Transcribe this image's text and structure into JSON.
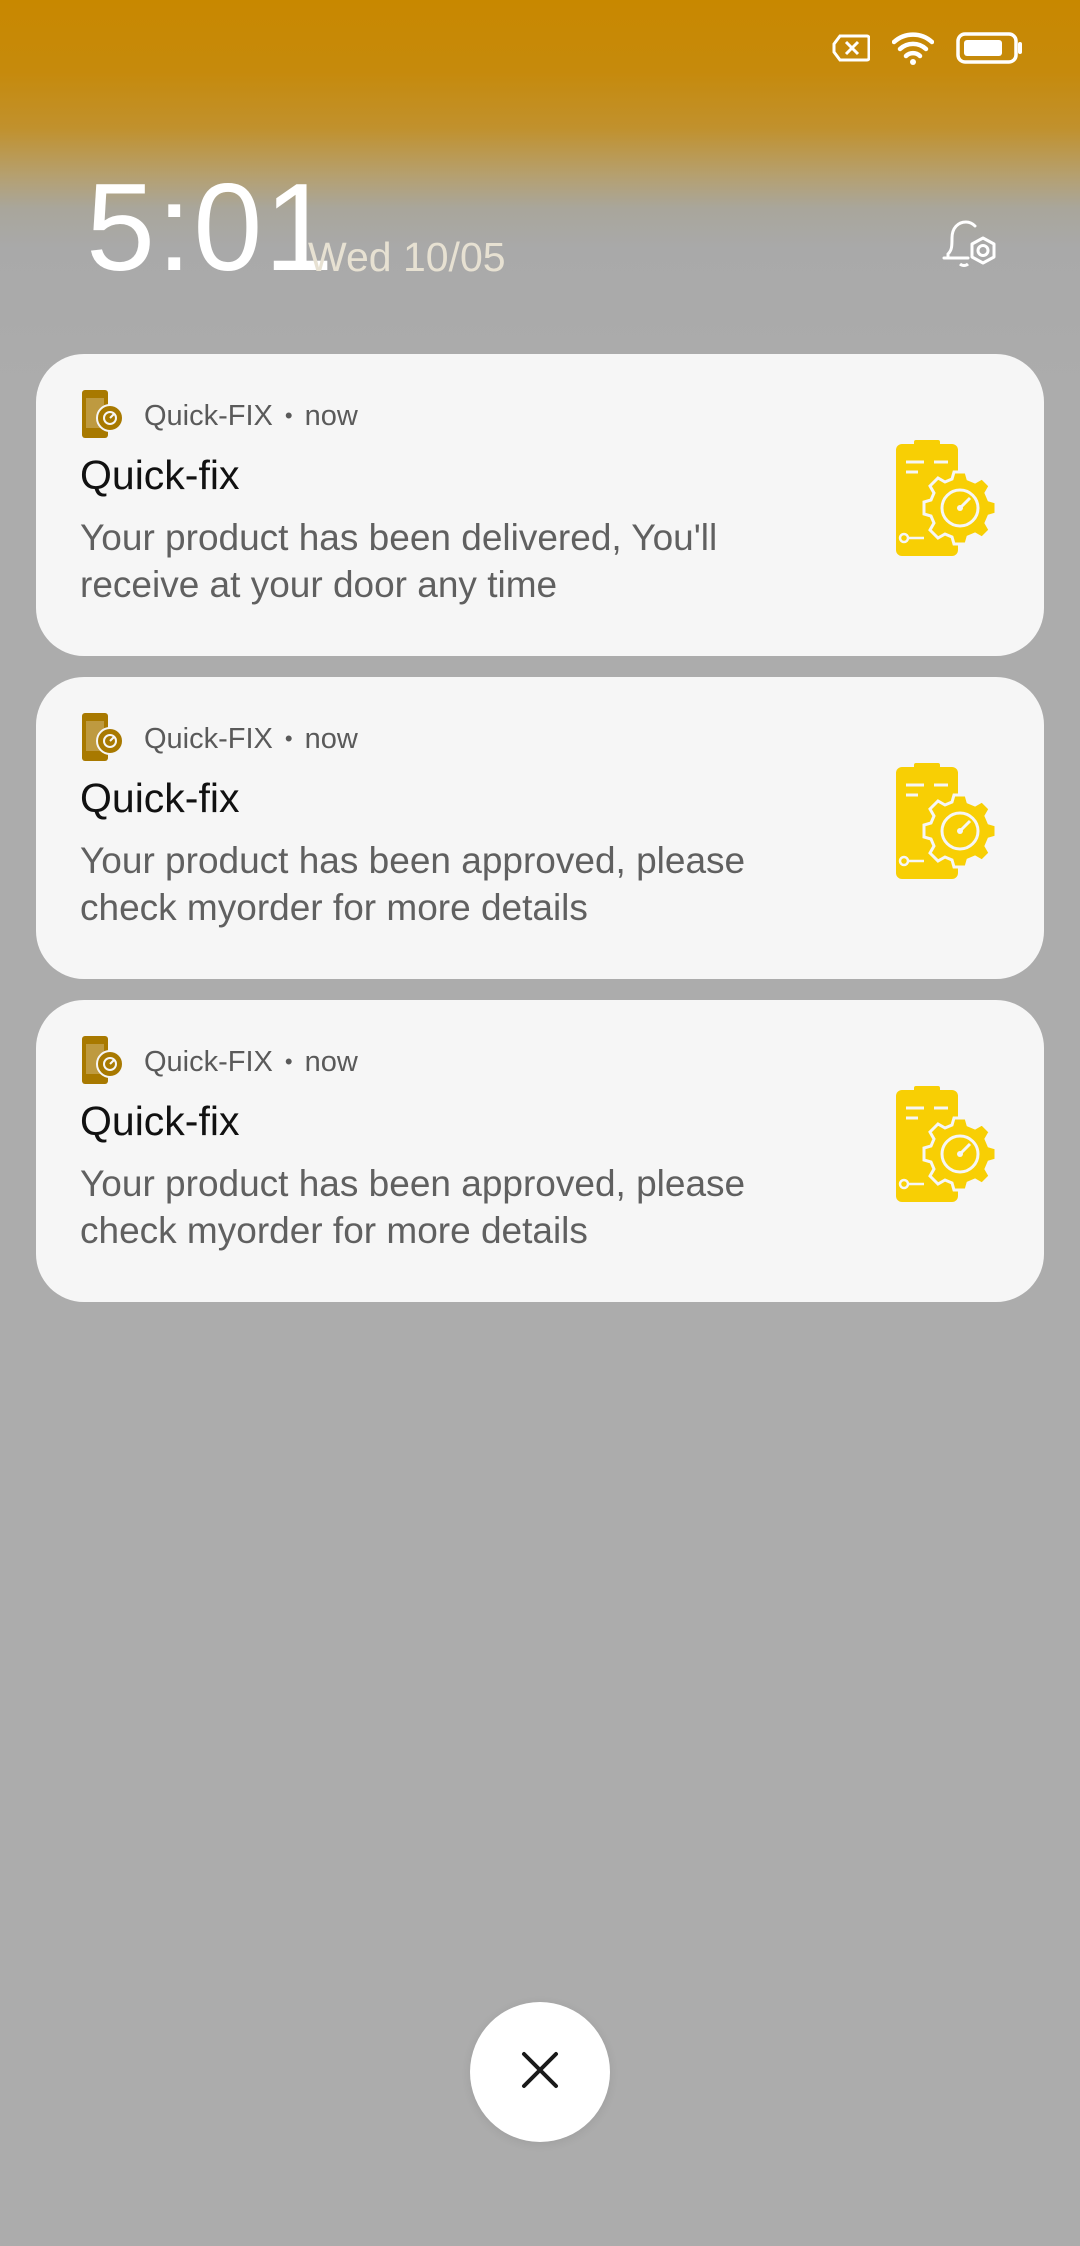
{
  "status_bar": {
    "icons": [
      "sim-card-x-icon",
      "wifi-icon",
      "battery-icon"
    ]
  },
  "lock": {
    "time": "5:01",
    "date": "Wed 10/05"
  },
  "colors": {
    "accent_top": "#c88800",
    "app_icon_small": "#a87900",
    "app_icon_large": "#f8cf04",
    "card_bg": "#f6f6f6",
    "screen_bg": "#acacac"
  },
  "notifications": [
    {
      "app_name": "Quick-FIX",
      "time": "now",
      "title": "Quick-fix",
      "body": "Your product has been delivered, You'll receive at your door any time"
    },
    {
      "app_name": "Quick-FIX",
      "time": "now",
      "title": "Quick-fix",
      "body": "Your product has been approved, please check myorder for more details"
    },
    {
      "app_name": "Quick-FIX",
      "time": "now",
      "title": "Quick-fix",
      "body": "Your product has been approved, please check myorder for more details"
    }
  ],
  "close": {
    "icon": "close-icon"
  }
}
